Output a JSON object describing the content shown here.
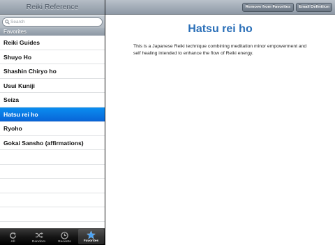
{
  "master": {
    "title": "Reiki Reference",
    "search": {
      "placeholder": "Search"
    },
    "section_header": "Favorites",
    "items": [
      {
        "label": "Reiki Guides"
      },
      {
        "label": "Shuyo Ho"
      },
      {
        "label": "Shashin Chiryo ho"
      },
      {
        "label": "Usui Kuniji"
      },
      {
        "label": "Seiza"
      },
      {
        "label": "Hatsu rei ho",
        "selected": true
      },
      {
        "label": "Ryoho"
      },
      {
        "label": "Gokai Sansho (affirmations)"
      }
    ]
  },
  "tabbar": {
    "tabs": [
      {
        "label": "All",
        "icon": "refresh-icon"
      },
      {
        "label": "Random",
        "icon": "shuffle-icon"
      },
      {
        "label": "Recents",
        "icon": "clock-icon"
      },
      {
        "label": "Favorites",
        "icon": "star-icon",
        "active": true
      }
    ]
  },
  "toolbar": {
    "remove_label": "Remove from Favorites",
    "email_label": "Email Definition"
  },
  "detail": {
    "title": "Hatsu rei ho",
    "definition": "This is a Japanese Reiki technique combining meditation minor empowerment and self healing intended to enhance the flow of Reiki energy."
  },
  "colors": {
    "selection": "#0a7ae6",
    "title": "#2a6fb8",
    "star_active": "#4aa3f5"
  }
}
